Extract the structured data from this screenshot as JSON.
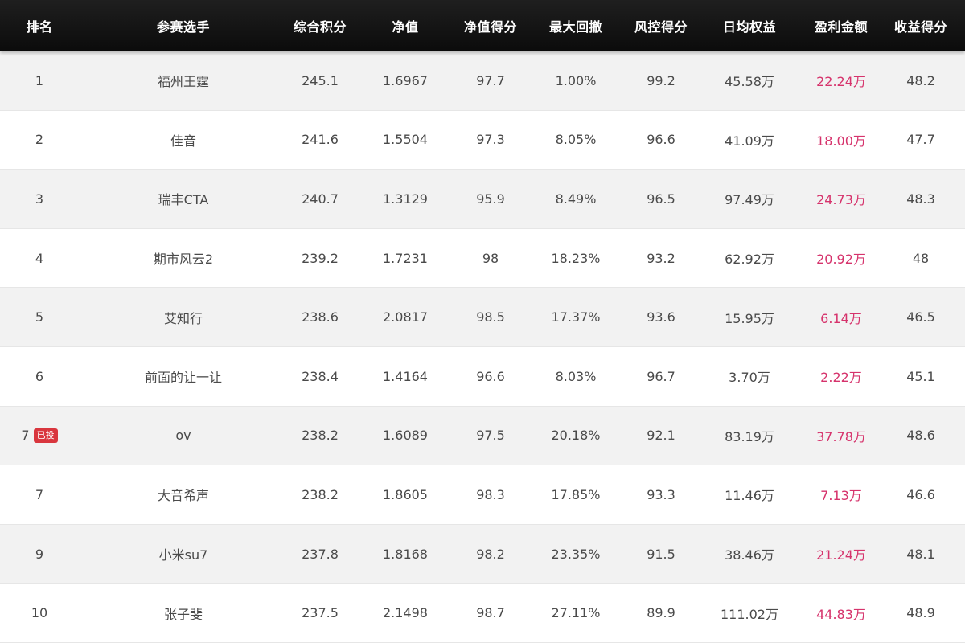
{
  "table": {
    "headers": {
      "rank": "排名",
      "player": "参赛选手",
      "score": "综合积分",
      "nav": "净值",
      "nav_score": "净值得分",
      "max_drawdown": "最大回撤",
      "risk_score": "风控得分",
      "daily_equity": "日均权益",
      "profit": "盈利金额",
      "return_score": "收益得分"
    },
    "rows": [
      {
        "rank": "1",
        "badge": "",
        "player": "福州王霆",
        "score": "245.1",
        "nav": "1.6967",
        "nav_score": "97.7",
        "max_drawdown": "1.00%",
        "risk_score": "99.2",
        "daily_equity": "45.58万",
        "profit": "22.24万",
        "return_score": "48.2"
      },
      {
        "rank": "2",
        "badge": "",
        "player": "佳音",
        "score": "241.6",
        "nav": "1.5504",
        "nav_score": "97.3",
        "max_drawdown": "8.05%",
        "risk_score": "96.6",
        "daily_equity": "41.09万",
        "profit": "18.00万",
        "return_score": "47.7"
      },
      {
        "rank": "3",
        "badge": "",
        "player": "瑞丰CTA",
        "score": "240.7",
        "nav": "1.3129",
        "nav_score": "95.9",
        "max_drawdown": "8.49%",
        "risk_score": "96.5",
        "daily_equity": "97.49万",
        "profit": "24.73万",
        "return_score": "48.3"
      },
      {
        "rank": "4",
        "badge": "",
        "player": "期市风云2",
        "score": "239.2",
        "nav": "1.7231",
        "nav_score": "98",
        "max_drawdown": "18.23%",
        "risk_score": "93.2",
        "daily_equity": "62.92万",
        "profit": "20.92万",
        "return_score": "48"
      },
      {
        "rank": "5",
        "badge": "",
        "player": "艾知行",
        "score": "238.6",
        "nav": "2.0817",
        "nav_score": "98.5",
        "max_drawdown": "17.37%",
        "risk_score": "93.6",
        "daily_equity": "15.95万",
        "profit": "6.14万",
        "return_score": "46.5"
      },
      {
        "rank": "6",
        "badge": "",
        "player": "前面的让一让",
        "score": "238.4",
        "nav": "1.4164",
        "nav_score": "96.6",
        "max_drawdown": "8.03%",
        "risk_score": "96.7",
        "daily_equity": "3.70万",
        "profit": "2.22万",
        "return_score": "45.1"
      },
      {
        "rank": "7",
        "badge": "已投",
        "player": "ov",
        "score": "238.2",
        "nav": "1.6089",
        "nav_score": "97.5",
        "max_drawdown": "20.18%",
        "risk_score": "92.1",
        "daily_equity": "83.19万",
        "profit": "37.78万",
        "return_score": "48.6"
      },
      {
        "rank": "7",
        "badge": "",
        "player": "大音希声",
        "score": "238.2",
        "nav": "1.8605",
        "nav_score": "98.3",
        "max_drawdown": "17.85%",
        "risk_score": "93.3",
        "daily_equity": "11.46万",
        "profit": "7.13万",
        "return_score": "46.6"
      },
      {
        "rank": "9",
        "badge": "",
        "player": "小米su7",
        "score": "237.8",
        "nav": "1.8168",
        "nav_score": "98.2",
        "max_drawdown": "23.35%",
        "risk_score": "91.5",
        "daily_equity": "38.46万",
        "profit": "21.24万",
        "return_score": "48.1"
      },
      {
        "rank": "10",
        "badge": "",
        "player": "张子斐",
        "score": "237.5",
        "nav": "2.1498",
        "nav_score": "98.7",
        "max_drawdown": "27.11%",
        "risk_score": "89.9",
        "daily_equity": "111.02万",
        "profit": "44.83万",
        "return_score": "48.9"
      }
    ]
  },
  "colors": {
    "header_bg": "#111111",
    "profit": "#d6336c",
    "badge": "#d9363e",
    "row_alt": "#f2f2f2"
  }
}
